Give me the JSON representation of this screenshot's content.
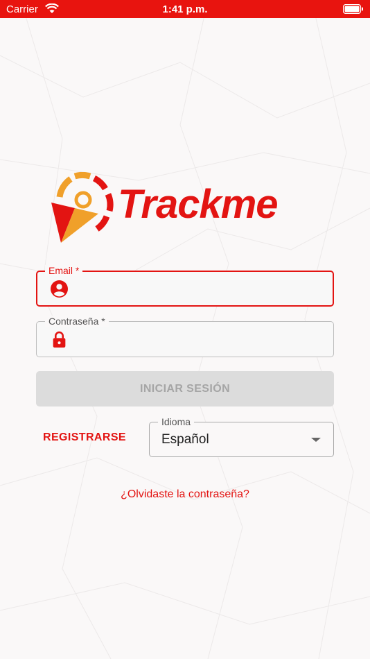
{
  "status_bar": {
    "carrier": "Carrier",
    "time": "1:41 p.m."
  },
  "app": {
    "name": "Trackme"
  },
  "colors": {
    "brand_red": "#e31412",
    "brand_orange": "#f0a02a",
    "disabled_bg": "#dcdcdc"
  },
  "login_form": {
    "email": {
      "label": "Email *",
      "value": "",
      "icon": "person-icon"
    },
    "password": {
      "label": "Contraseña *",
      "value": "",
      "icon": "lock-icon"
    },
    "submit_label": "INICIAR SESIÓN"
  },
  "register_label": "REGISTRARSE",
  "language": {
    "label": "Idioma",
    "selected": "Español"
  },
  "forgot_password": "¿Olvidaste la contraseña?"
}
